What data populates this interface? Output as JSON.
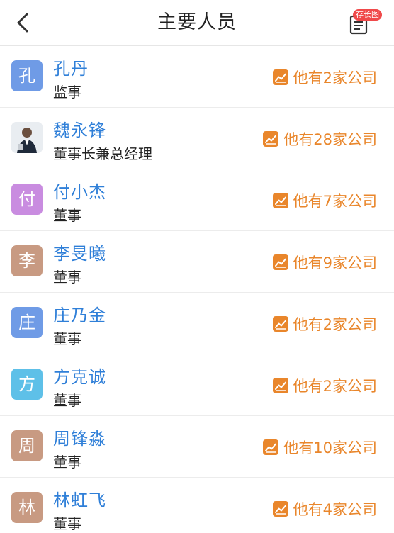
{
  "header": {
    "title": "主要人员",
    "save_badge": "存长图"
  },
  "colors": {
    "name_blue": "#2f7fd8",
    "link_orange": "#e9862b",
    "badge_red": "#f0494a"
  },
  "people": [
    {
      "avatar_char": "孔",
      "avatar_color": "#6f9be6",
      "name": "孔丹",
      "role": "监事",
      "companies": "他有2家公司",
      "icon": "trend-chart-icon"
    },
    {
      "avatar_char": "",
      "avatar_color": "#eef0f2",
      "avatar_photo": true,
      "name": "魏永锋",
      "role": "董事长兼总经理",
      "companies": "他有28家公司",
      "icon": "trend-chart-icon"
    },
    {
      "avatar_char": "付",
      "avatar_color": "#c98ce0",
      "name": "付小杰",
      "role": "董事",
      "companies": "他有7家公司",
      "icon": "trend-chart-icon"
    },
    {
      "avatar_char": "李",
      "avatar_color": "#c89a82",
      "name": "李旻曦",
      "role": "董事",
      "companies": "他有9家公司",
      "icon": "trend-chart-icon"
    },
    {
      "avatar_char": "庄",
      "avatar_color": "#6f9be6",
      "name": "庄乃金",
      "role": "董事",
      "companies": "他有2家公司",
      "icon": "trend-chart-icon"
    },
    {
      "avatar_char": "方",
      "avatar_color": "#5ec0e8",
      "name": "方克诚",
      "role": "董事",
      "companies": "他有2家公司",
      "icon": "trend-chart-icon"
    },
    {
      "avatar_char": "周",
      "avatar_color": "#c89a82",
      "name": "周锋淼",
      "role": "董事",
      "companies": "他有10家公司",
      "icon": "trend-chart-icon"
    },
    {
      "avatar_char": "林",
      "avatar_color": "#c89a82",
      "name": "林虹飞",
      "role": "董事",
      "companies": "他有4家公司",
      "icon": "trend-chart-icon"
    }
  ]
}
